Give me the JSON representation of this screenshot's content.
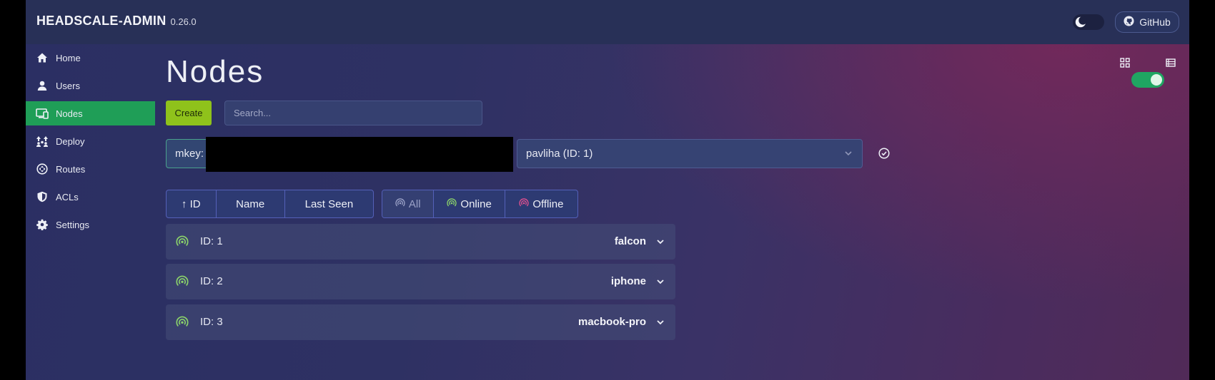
{
  "header": {
    "title": "HEADSCALE-ADMIN",
    "version": "0.26.0",
    "github_label": "GitHub"
  },
  "sidebar": {
    "items": [
      {
        "label": "Home",
        "icon": "home-icon",
        "active": false
      },
      {
        "label": "Users",
        "icon": "user-icon",
        "active": false
      },
      {
        "label": "Nodes",
        "icon": "devices-icon",
        "active": true
      },
      {
        "label": "Deploy",
        "icon": "deploy-icon",
        "active": false
      },
      {
        "label": "Routes",
        "icon": "routes-icon",
        "active": false
      },
      {
        "label": "ACLs",
        "icon": "shield-icon",
        "active": false
      },
      {
        "label": "Settings",
        "icon": "gear-icon",
        "active": false
      }
    ]
  },
  "main": {
    "title": "Nodes",
    "create_label": "Create",
    "search_placeholder": "Search...",
    "mkey_value": "mkey:",
    "user_select_value": "pavliha (ID: 1)",
    "sort_buttons": [
      "↑ ID",
      "Name",
      "Last Seen"
    ],
    "filter_buttons": [
      "All",
      "Online",
      "Offline"
    ],
    "view_toggle_on": true
  },
  "nodes": [
    {
      "id": "ID: 1",
      "name": "falcon",
      "status": "online"
    },
    {
      "id": "ID: 2",
      "name": "iphone",
      "status": "online"
    },
    {
      "id": "ID: 3",
      "name": "macbook-pro",
      "status": "online"
    }
  ],
  "colors": {
    "accent": "#1f9e57",
    "create": "#8fc21b",
    "online": "#8bd36a",
    "offline": "#e0508f"
  }
}
